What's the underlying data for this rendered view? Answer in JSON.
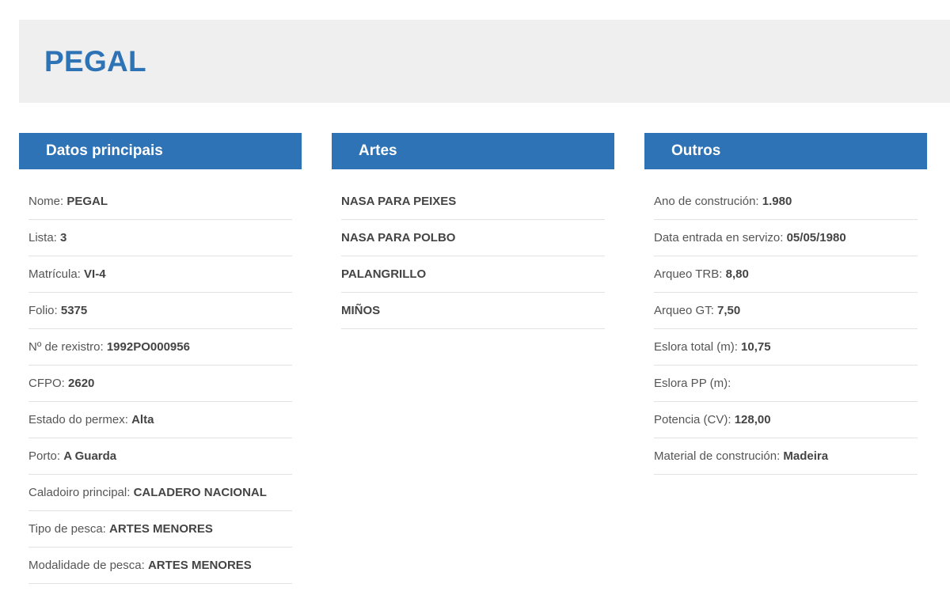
{
  "page": {
    "title": "PEGAL"
  },
  "datos_principais": {
    "heading": "Datos principais",
    "rows": [
      {
        "label": "Nome: ",
        "value": "PEGAL"
      },
      {
        "label": "Lista: ",
        "value": "3"
      },
      {
        "label": "Matrícula: ",
        "value": "VI-4"
      },
      {
        "label": "Folio: ",
        "value": "5375"
      },
      {
        "label": "Nº de rexistro: ",
        "value": "1992PO000956"
      },
      {
        "label": "CFPO: ",
        "value": "2620"
      },
      {
        "label": "Estado do permex: ",
        "value": "Alta"
      },
      {
        "label": "Porto: ",
        "value": "A Guarda"
      },
      {
        "label": "Caladoiro principal: ",
        "value": "CALADERO NACIONAL"
      },
      {
        "label": "Tipo de pesca: ",
        "value": "ARTES MENORES"
      },
      {
        "label": "Modalidade de pesca: ",
        "value": "ARTES MENORES"
      }
    ]
  },
  "artes": {
    "heading": "Artes",
    "items": [
      "NASA PARA PEIXES",
      "NASA PARA POLBO",
      "PALANGRILLO",
      "MIÑOS"
    ]
  },
  "outros": {
    "heading": "Outros",
    "rows": [
      {
        "label": "Ano de construción: ",
        "value": "1.980"
      },
      {
        "label": "Data entrada en servizo: ",
        "value": "05/05/1980"
      },
      {
        "label": "Arqueo TRB: ",
        "value": "8,80"
      },
      {
        "label": "Arqueo GT: ",
        "value": "7,50"
      },
      {
        "label": "Eslora total (m): ",
        "value": "10,75"
      },
      {
        "label": "Eslora PP (m): ",
        "value": ""
      },
      {
        "label": "Potencia (CV): ",
        "value": "128,00"
      },
      {
        "label": "Material de construción: ",
        "value": "Madeira"
      }
    ]
  }
}
